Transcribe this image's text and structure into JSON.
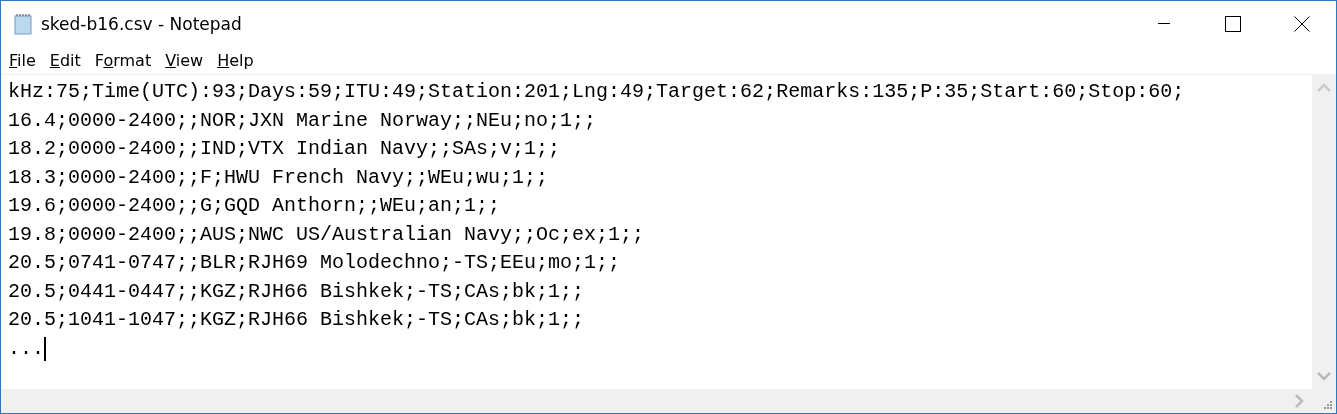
{
  "window": {
    "title": "sked-b16.csv - Notepad"
  },
  "menu": [
    {
      "key": "F",
      "after": "ile"
    },
    {
      "key": "E",
      "after": "dit"
    },
    {
      "before": "F",
      "key": "o",
      "after": "rmat"
    },
    {
      "key": "V",
      "after": "iew"
    },
    {
      "key": "H",
      "after": "elp"
    }
  ],
  "editor": {
    "lines": [
      "kHz:75;Time(UTC):93;Days:59;ITU:49;Station:201;Lng:49;Target:62;Remarks:135;P:35;Start:60;Stop:60;",
      "16.4;0000-2400;;NOR;JXN Marine Norway;;NEu;no;1;;",
      "18.2;0000-2400;;IND;VTX Indian Navy;;SAs;v;1;;",
      "18.3;0000-2400;;F;HWU French Navy;;WEu;wu;1;;",
      "19.6;0000-2400;;G;GQD Anthorn;;WEu;an;1;;",
      "19.8;0000-2400;;AUS;NWC US/Australian Navy;;Oc;ex;1;;",
      "20.5;0741-0747;;BLR;RJH69 Molodechno;-TS;EEu;mo;1;;",
      "20.5;0441-0447;;KGZ;RJH66 Bishkek;-TS;CAs;bk;1;;",
      "20.5;1041-1047;;KGZ;RJH66 Bishkek;-TS;CAs;bk;1;;",
      "..."
    ]
  }
}
